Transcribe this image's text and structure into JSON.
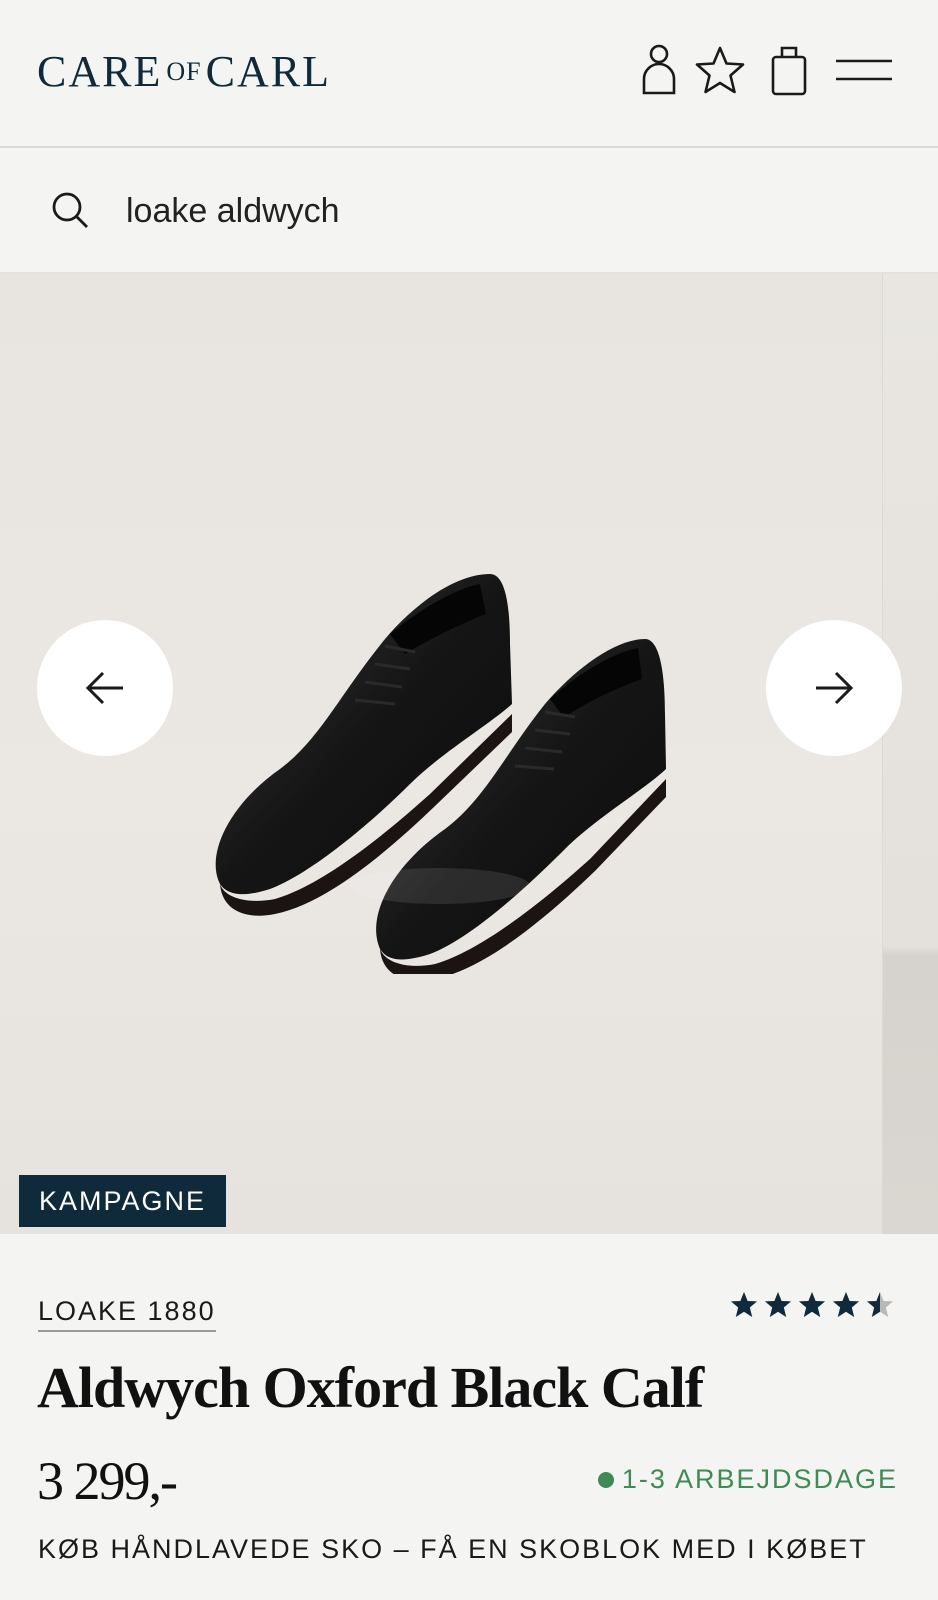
{
  "header": {
    "logo_left": "CARE",
    "logo_of": "OF",
    "logo_right": "CARL",
    "icons": [
      "user-icon",
      "star-icon",
      "bag-icon",
      "menu-icon"
    ]
  },
  "search": {
    "query": "loake aldwych"
  },
  "gallery": {
    "badge": "KAMPAGNE"
  },
  "product": {
    "brand": "LOAKE 1880",
    "title": "Aldwych Oxford Black Calf",
    "price": "3 299,-",
    "rating": 4.5,
    "rating_max": 5,
    "delivery": "1-3 ARBEJDSDAGE",
    "promo": "KØB HÅNDLAVEDE SKO – FÅ EN SKOBLOK MED I KØBET"
  },
  "colors": {
    "navy": "#0f2a3a",
    "background": "#f4f4f2",
    "delivery_green": "#3f8a55"
  }
}
